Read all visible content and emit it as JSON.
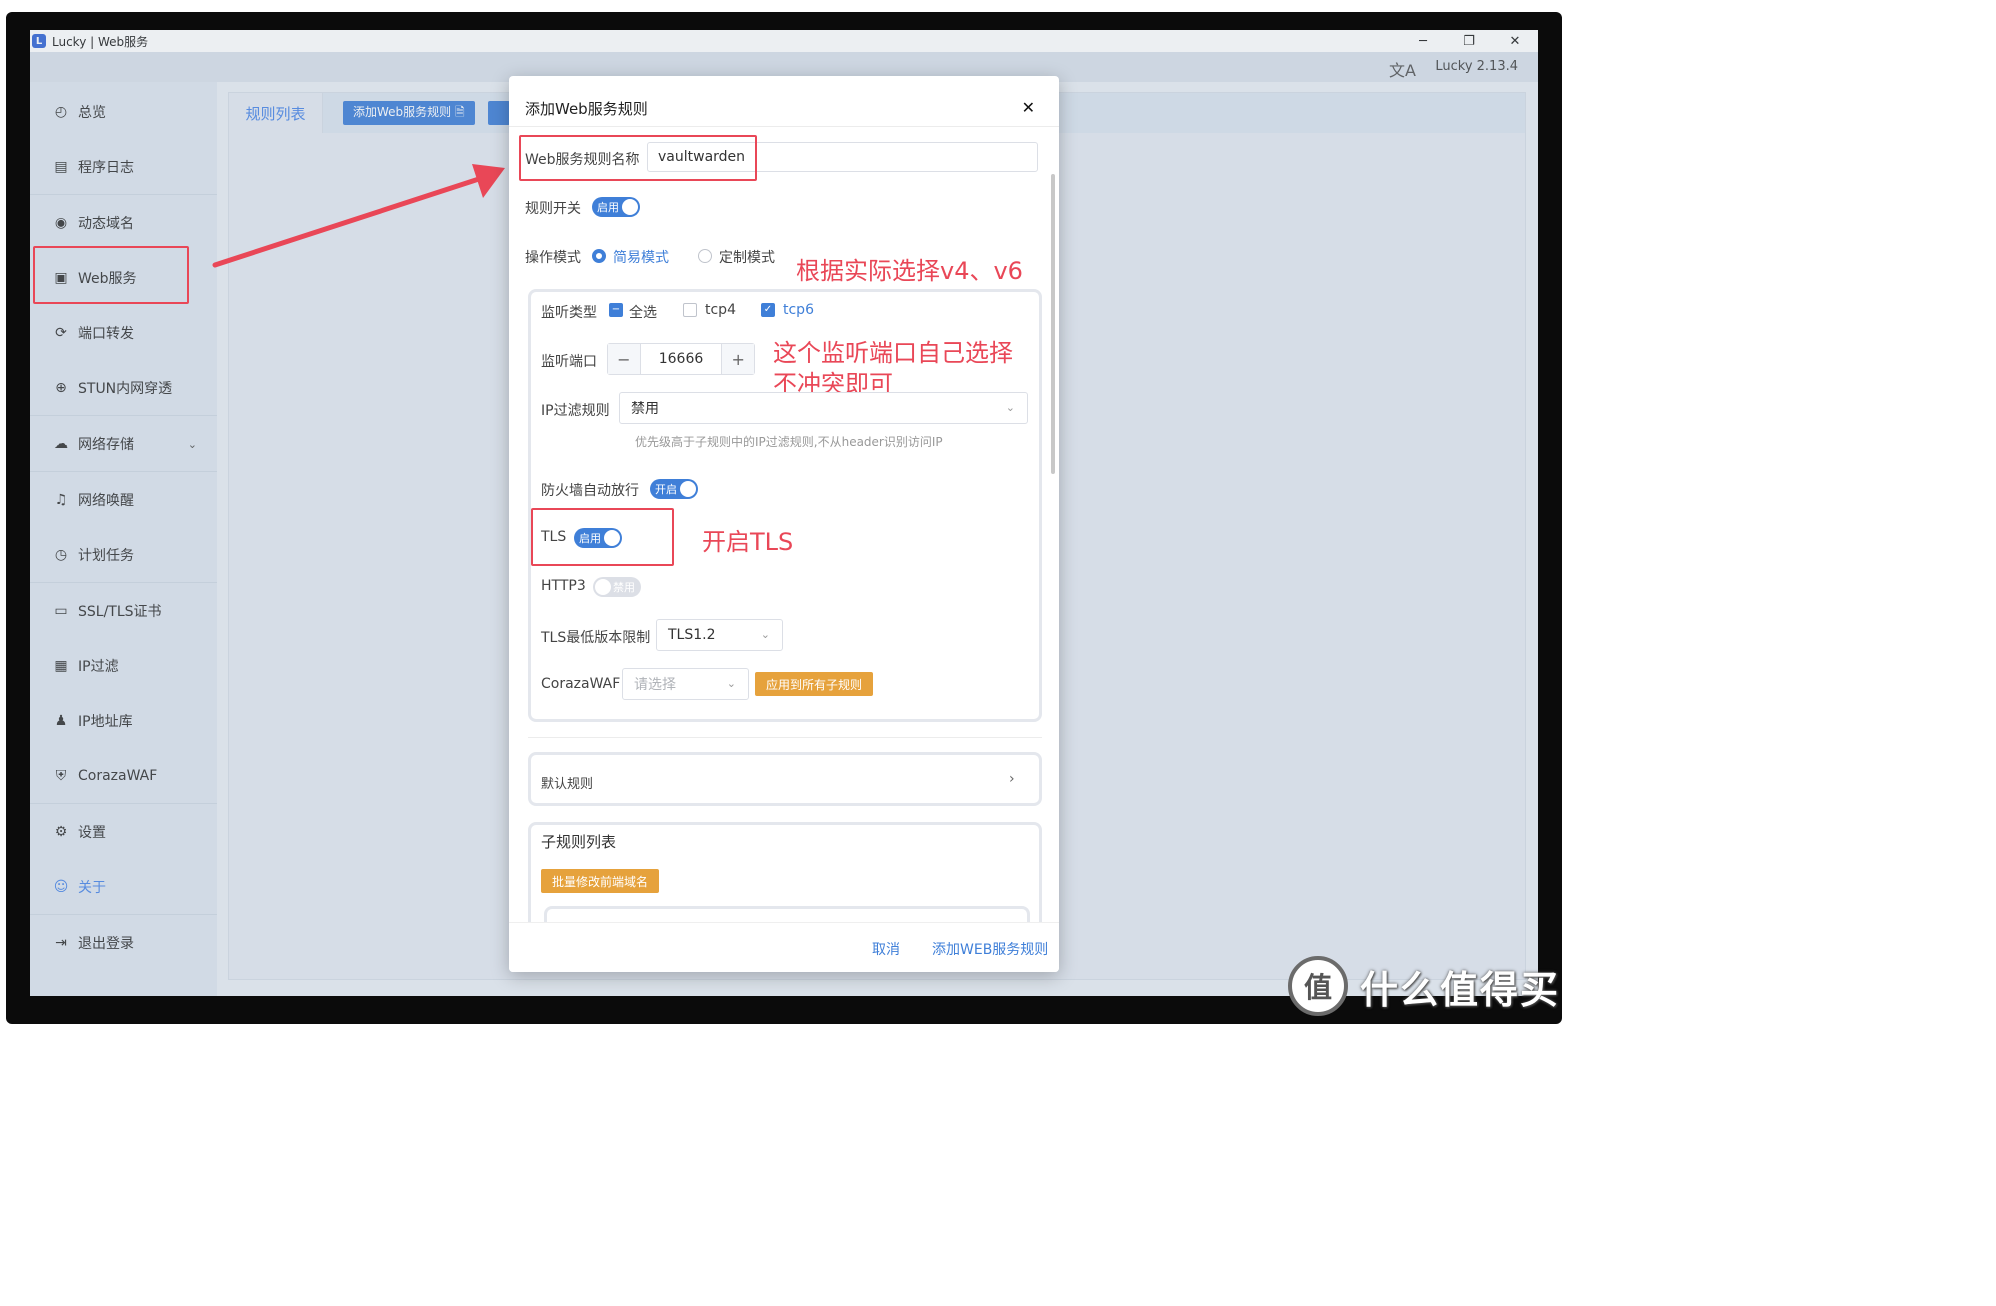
{
  "window": {
    "title": "Lucky | Web服务",
    "version": "Lucky 2.13.4",
    "controls": {
      "minimize": "─",
      "maximize": "❐",
      "close": "✕"
    }
  },
  "sidebar": {
    "items": [
      {
        "label": "总览",
        "icon": "dashboard-icon",
        "glyph": "◴"
      },
      {
        "label": "程序日志",
        "icon": "log-icon",
        "glyph": "▤"
      },
      {
        "label": "动态域名",
        "icon": "dns-icon",
        "glyph": "◉"
      },
      {
        "label": "Web服务",
        "icon": "web-service-icon",
        "glyph": "▣"
      },
      {
        "label": "端口转发",
        "icon": "port-forward-icon",
        "glyph": "⟳"
      },
      {
        "label": "STUN内网穿透",
        "icon": "stun-icon",
        "glyph": "⊕"
      },
      {
        "label": "网络存储",
        "icon": "cloud-storage-icon",
        "glyph": "☁"
      },
      {
        "label": "网络唤醒",
        "icon": "bell-icon",
        "glyph": "♫"
      },
      {
        "label": "计划任务",
        "icon": "clock-icon",
        "glyph": "◷"
      },
      {
        "label": "SSL/TLS证书",
        "icon": "certificate-icon",
        "glyph": "▭"
      },
      {
        "label": "IP过滤",
        "icon": "ip-filter-icon",
        "glyph": "▦"
      },
      {
        "label": "IP地址库",
        "icon": "ip-database-icon",
        "glyph": "♟"
      },
      {
        "label": "CorazaWAF",
        "icon": "shield-icon",
        "glyph": "⛨"
      },
      {
        "label": "设置",
        "icon": "gear-icon",
        "glyph": "⚙"
      },
      {
        "label": "关于",
        "icon": "about-icon",
        "glyph": "☺"
      },
      {
        "label": "退出登录",
        "icon": "logout-icon",
        "glyph": "⇥"
      }
    ],
    "chevron": "⌄"
  },
  "content": {
    "tab_label": "规则列表",
    "add_button": "添加Web服务规则 🗎"
  },
  "dialog": {
    "title": "添加Web服务规则",
    "close": "✕",
    "rule_name_label": "Web服务规则名称",
    "rule_name_value": "vaultwarden",
    "rule_switch_label": "规则开关",
    "rule_switch_text": "启用",
    "mode_label": "操作模式",
    "mode_simple": "简易模式",
    "mode_custom": "定制模式",
    "listen_type_label": "监听类型",
    "select_all": "全选",
    "tcp4": "tcp4",
    "tcp6": "tcp6",
    "listen_port_label": "监听端口",
    "listen_port_value": "16666",
    "minus": "−",
    "plus": "+",
    "ip_filter_label": "IP过滤规则",
    "ip_filter_value": "禁用",
    "ip_filter_hint": "优先级高于子规则中的IP过滤规则,不从header识别访问IP",
    "firewall_label": "防火墙自动放行",
    "firewall_text": "开启",
    "tls_label": "TLS",
    "tls_text": "启用",
    "http3_label": "HTTP3",
    "http3_text": "禁用",
    "tls_min_label": "TLS最低版本限制",
    "tls_min_value": "TLS1.2",
    "waf_label": "CorazaWAF",
    "waf_placeholder": "请选择",
    "apply_all_button": "应用到所有子规则",
    "default_rule_label": "默认规则",
    "sub_rules_title": "子规则列表",
    "batch_button": "批量修改前端域名",
    "cancel_button": "取消",
    "confirm_button": "添加WEB服务规则"
  },
  "annotations": {
    "choose_v4_v6": "根据实际选择v4、v6",
    "port_note_line1": "这个监听端口自己选择",
    "port_note_line2": "不冲突即可",
    "enable_tls": "开启TLS"
  },
  "watermark": {
    "logo_char": "值",
    "text": "什么值得买"
  },
  "colors": {
    "accent": "#3f7fd8",
    "annotation_red": "#e94757",
    "warning_orange": "#e6a23c"
  }
}
